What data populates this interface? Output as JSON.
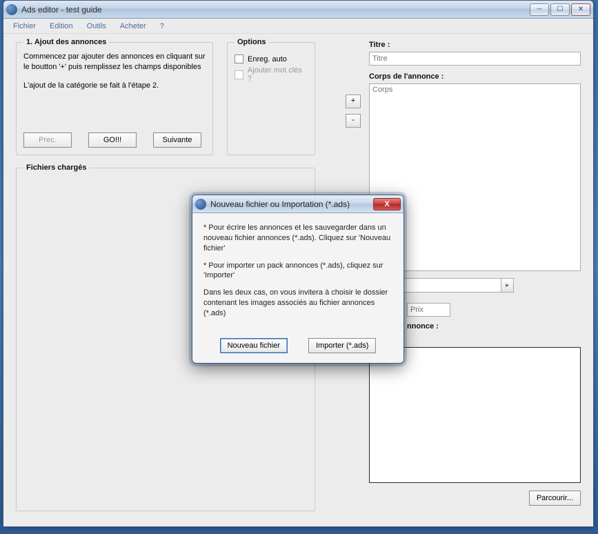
{
  "window": {
    "title": "Ads editor - test guide"
  },
  "menu": {
    "fichier": "Fichier",
    "edition": "Edition",
    "outils": "Outils",
    "acheter": "Acheter",
    "help": "?"
  },
  "step": {
    "legend": "1. Ajout des annonces",
    "line1": "Commencez par ajouter des annonces en cliquant sur le boutton '+' puis remplissez les champs disponibles",
    "line2": "L'ajout de la catégorie se fait à l'étape 2.",
    "prev": "Prec.",
    "go": "GO!!!",
    "next": "Suivante"
  },
  "options": {
    "legend": "Options",
    "auto_save": "Enreg. auto",
    "add_keywords": "Ajouter mot clés ?"
  },
  "files": {
    "legend": "Fichiers chargés"
  },
  "form": {
    "titre_label": "Titre :",
    "titre_placeholder": "Titre",
    "corps_label": "Corps de l'annonce :",
    "corps_placeholder": "Corps",
    "plus": "+",
    "minus": "-",
    "prix_placeholder": "Prix",
    "annonce_label_suffix": "nnonce :",
    "parcourir": "Parcourir..."
  },
  "modal": {
    "title": "Nouveau fichier ou Importation (*.ads)",
    "p1": "* Pour écrire les annonces et les sauvegarder dans un nouveau fichier annonces (*.ads). Cliquez sur 'Nouveau fichier'",
    "p2": "* Pour importer un pack annonces (*.ads), cliquez sur 'Importer'",
    "p3": "Dans les deux cas, on vous invitera à choisir le dossier contenant les images associés au fichier annonces (*.ads)",
    "btn_new": "Nouveau fichier",
    "btn_import": "Importer (*.ads)"
  }
}
